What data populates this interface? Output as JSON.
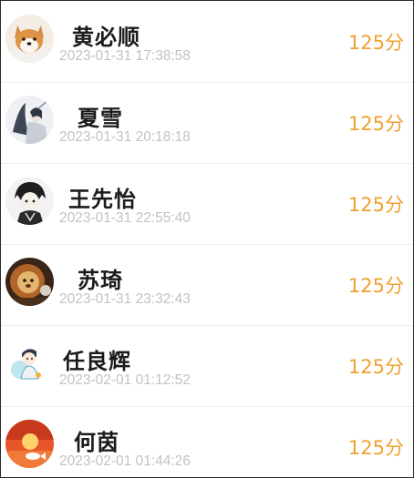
{
  "colors": {
    "score": "#f0a030",
    "timestamp": "#c2c2c2",
    "name": "#1b1b1b",
    "divider": "#ededed"
  },
  "records": [
    {
      "name": "黄必顺",
      "time": "2023-01-31 17:38:58",
      "score": "125分",
      "avatar_icon": "shiba-dog-avatar"
    },
    {
      "name": "夏雪",
      "time": "2023-01-31 20:18:18",
      "score": "125分",
      "avatar_icon": "ink-illustration-avatar"
    },
    {
      "name": "王先怡",
      "time": "2023-01-31 22:55:40",
      "score": "125分",
      "avatar_icon": "anime-character-avatar"
    },
    {
      "name": "苏琦",
      "time": "2023-01-31 23:32:43",
      "score": "125分",
      "avatar_icon": "plush-lion-avatar"
    },
    {
      "name": "任良辉",
      "time": "2023-02-01 01:12:52",
      "score": "125分",
      "avatar_icon": "cartoon-boy-avatar"
    },
    {
      "name": "何茵",
      "time": "2023-02-01 01:44:26",
      "score": "125分",
      "avatar_icon": "sunset-goldfish-avatar"
    }
  ]
}
